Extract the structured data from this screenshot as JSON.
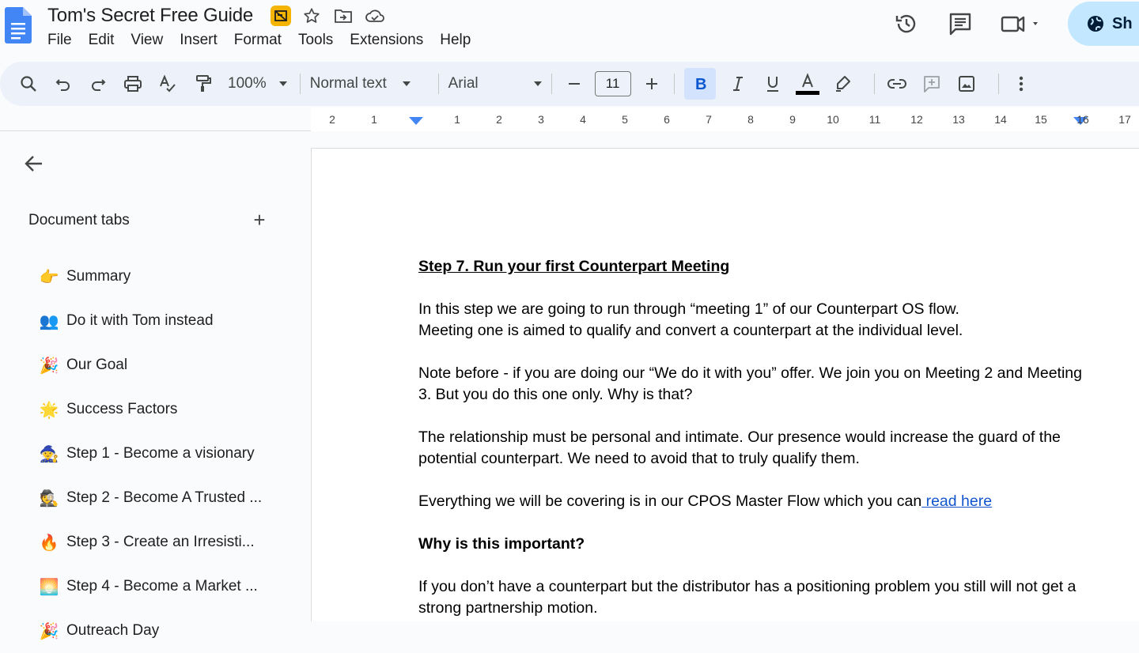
{
  "header": {
    "title": "Tom's Secret Free Guide",
    "menu": [
      "File",
      "Edit",
      "View",
      "Insert",
      "Format",
      "Tools",
      "Extensions",
      "Help"
    ],
    "share_label": "Sh"
  },
  "toolbar": {
    "zoom": "100%",
    "style": "Normal text",
    "font": "Arial",
    "font_size": "11"
  },
  "ruler": {
    "labels": [
      "2",
      "1",
      "1",
      "2",
      "3",
      "4",
      "5",
      "6",
      "7",
      "8",
      "9",
      "10",
      "11",
      "12",
      "13",
      "14",
      "15",
      "16",
      "17"
    ]
  },
  "sidebar": {
    "header": "Document tabs",
    "tabs": [
      {
        "emoji": "👉",
        "label": "Summary"
      },
      {
        "emoji": "👥",
        "label": "Do it with Tom instead"
      },
      {
        "emoji": "🎉",
        "label": "Our Goal"
      },
      {
        "emoji": "🌟",
        "label": "Success Factors"
      },
      {
        "emoji": "🧙",
        "label": "Step 1 - Become a visionary"
      },
      {
        "emoji": "🕵",
        "label": "Step 2 - Become A Trusted ..."
      },
      {
        "emoji": "🔥",
        "label": "Step 3 - Create an Irresisti..."
      },
      {
        "emoji": "🌅",
        "label": "Step 4 - Become a Market ..."
      },
      {
        "emoji": "🎉",
        "label": "Outreach Day"
      }
    ]
  },
  "document": {
    "heading": "Step 7. Run your first Counterpart Meeting",
    "p1_line1": "In this step we are going to run through “meeting 1” of our Counterpart OS flow.",
    "p1_line2": "Meeting one is aimed to qualify and convert a counterpart at the individual level.",
    "p2": "Note before - if you are doing our “We do it with you” offer. We join you on Meeting 2 and Meeting 3. But you do this one only. Why is that?",
    "p3": "The relationship must be personal and intimate. Our presence would increase the guard of the potential counterpart. We need to avoid that to truly qualify them.",
    "p4_text": "Everything we will be covering is in our CPOS Master Flow which you can",
    "p4_link": " read here",
    "subheading": "Why is this important?",
    "p5": "If you don’t have a counterpart but the distributor has a positioning problem you still will not get a strong partnership motion."
  }
}
